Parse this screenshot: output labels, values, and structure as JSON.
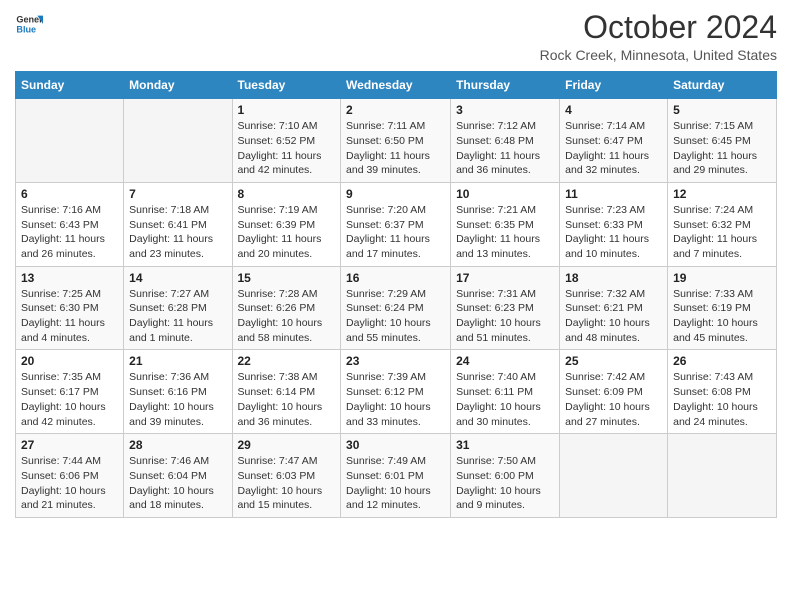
{
  "header": {
    "logo_line1": "General",
    "logo_line2": "Blue",
    "title": "October 2024",
    "subtitle": "Rock Creek, Minnesota, United States"
  },
  "columns": [
    "Sunday",
    "Monday",
    "Tuesday",
    "Wednesday",
    "Thursday",
    "Friday",
    "Saturday"
  ],
  "weeks": [
    [
      {
        "day": "",
        "text": ""
      },
      {
        "day": "",
        "text": ""
      },
      {
        "day": "1",
        "text": "Sunrise: 7:10 AM\nSunset: 6:52 PM\nDaylight: 11 hours and 42 minutes."
      },
      {
        "day": "2",
        "text": "Sunrise: 7:11 AM\nSunset: 6:50 PM\nDaylight: 11 hours and 39 minutes."
      },
      {
        "day": "3",
        "text": "Sunrise: 7:12 AM\nSunset: 6:48 PM\nDaylight: 11 hours and 36 minutes."
      },
      {
        "day": "4",
        "text": "Sunrise: 7:14 AM\nSunset: 6:47 PM\nDaylight: 11 hours and 32 minutes."
      },
      {
        "day": "5",
        "text": "Sunrise: 7:15 AM\nSunset: 6:45 PM\nDaylight: 11 hours and 29 minutes."
      }
    ],
    [
      {
        "day": "6",
        "text": "Sunrise: 7:16 AM\nSunset: 6:43 PM\nDaylight: 11 hours and 26 minutes."
      },
      {
        "day": "7",
        "text": "Sunrise: 7:18 AM\nSunset: 6:41 PM\nDaylight: 11 hours and 23 minutes."
      },
      {
        "day": "8",
        "text": "Sunrise: 7:19 AM\nSunset: 6:39 PM\nDaylight: 11 hours and 20 minutes."
      },
      {
        "day": "9",
        "text": "Sunrise: 7:20 AM\nSunset: 6:37 PM\nDaylight: 11 hours and 17 minutes."
      },
      {
        "day": "10",
        "text": "Sunrise: 7:21 AM\nSunset: 6:35 PM\nDaylight: 11 hours and 13 minutes."
      },
      {
        "day": "11",
        "text": "Sunrise: 7:23 AM\nSunset: 6:33 PM\nDaylight: 11 hours and 10 minutes."
      },
      {
        "day": "12",
        "text": "Sunrise: 7:24 AM\nSunset: 6:32 PM\nDaylight: 11 hours and 7 minutes."
      }
    ],
    [
      {
        "day": "13",
        "text": "Sunrise: 7:25 AM\nSunset: 6:30 PM\nDaylight: 11 hours and 4 minutes."
      },
      {
        "day": "14",
        "text": "Sunrise: 7:27 AM\nSunset: 6:28 PM\nDaylight: 11 hours and 1 minute."
      },
      {
        "day": "15",
        "text": "Sunrise: 7:28 AM\nSunset: 6:26 PM\nDaylight: 10 hours and 58 minutes."
      },
      {
        "day": "16",
        "text": "Sunrise: 7:29 AM\nSunset: 6:24 PM\nDaylight: 10 hours and 55 minutes."
      },
      {
        "day": "17",
        "text": "Sunrise: 7:31 AM\nSunset: 6:23 PM\nDaylight: 10 hours and 51 minutes."
      },
      {
        "day": "18",
        "text": "Sunrise: 7:32 AM\nSunset: 6:21 PM\nDaylight: 10 hours and 48 minutes."
      },
      {
        "day": "19",
        "text": "Sunrise: 7:33 AM\nSunset: 6:19 PM\nDaylight: 10 hours and 45 minutes."
      }
    ],
    [
      {
        "day": "20",
        "text": "Sunrise: 7:35 AM\nSunset: 6:17 PM\nDaylight: 10 hours and 42 minutes."
      },
      {
        "day": "21",
        "text": "Sunrise: 7:36 AM\nSunset: 6:16 PM\nDaylight: 10 hours and 39 minutes."
      },
      {
        "day": "22",
        "text": "Sunrise: 7:38 AM\nSunset: 6:14 PM\nDaylight: 10 hours and 36 minutes."
      },
      {
        "day": "23",
        "text": "Sunrise: 7:39 AM\nSunset: 6:12 PM\nDaylight: 10 hours and 33 minutes."
      },
      {
        "day": "24",
        "text": "Sunrise: 7:40 AM\nSunset: 6:11 PM\nDaylight: 10 hours and 30 minutes."
      },
      {
        "day": "25",
        "text": "Sunrise: 7:42 AM\nSunset: 6:09 PM\nDaylight: 10 hours and 27 minutes."
      },
      {
        "day": "26",
        "text": "Sunrise: 7:43 AM\nSunset: 6:08 PM\nDaylight: 10 hours and 24 minutes."
      }
    ],
    [
      {
        "day": "27",
        "text": "Sunrise: 7:44 AM\nSunset: 6:06 PM\nDaylight: 10 hours and 21 minutes."
      },
      {
        "day": "28",
        "text": "Sunrise: 7:46 AM\nSunset: 6:04 PM\nDaylight: 10 hours and 18 minutes."
      },
      {
        "day": "29",
        "text": "Sunrise: 7:47 AM\nSunset: 6:03 PM\nDaylight: 10 hours and 15 minutes."
      },
      {
        "day": "30",
        "text": "Sunrise: 7:49 AM\nSunset: 6:01 PM\nDaylight: 10 hours and 12 minutes."
      },
      {
        "day": "31",
        "text": "Sunrise: 7:50 AM\nSunset: 6:00 PM\nDaylight: 10 hours and 9 minutes."
      },
      {
        "day": "",
        "text": ""
      },
      {
        "day": "",
        "text": ""
      }
    ]
  ]
}
